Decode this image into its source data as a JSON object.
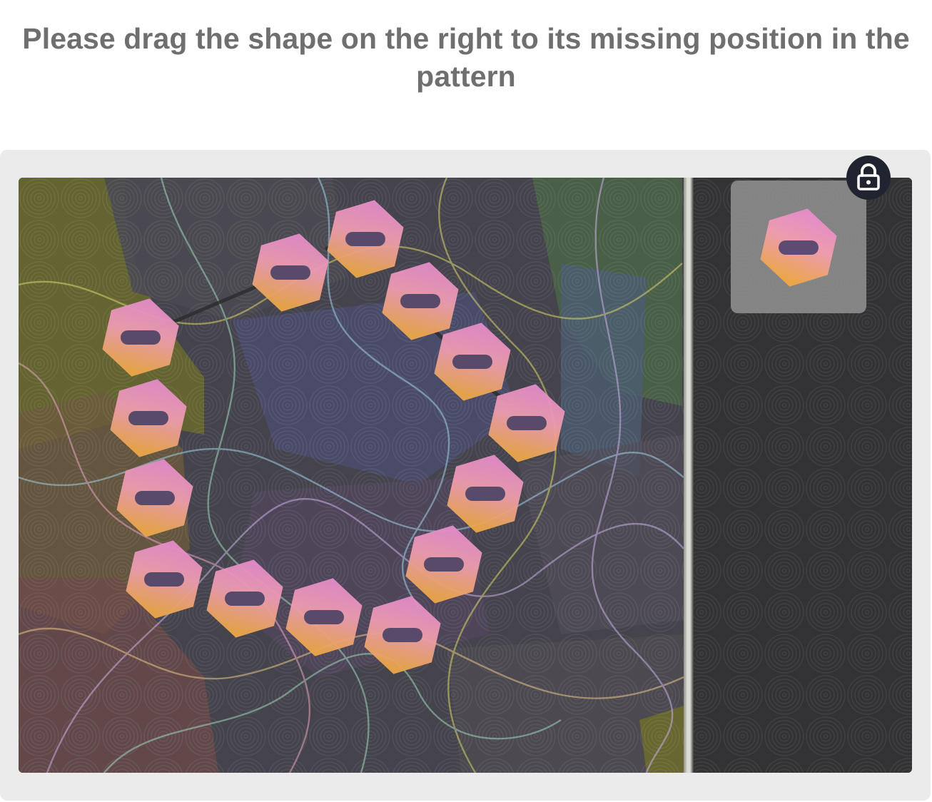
{
  "instruction": {
    "text": "Please drag the shape on the right to its missing position in the pattern"
  },
  "lock": {
    "icon": "lock-icon"
  },
  "colors": {
    "text": "#6f6f6f",
    "panel": "#ebebeb",
    "board_base": "#3a3a40",
    "tile_pink": "#e48cc8",
    "tile_orange": "#eba64a",
    "slot": "#5a4a6a",
    "lock_bg": "#1f2430"
  },
  "pattern": {
    "tile_count": 14,
    "missing_piece_count": 1
  }
}
